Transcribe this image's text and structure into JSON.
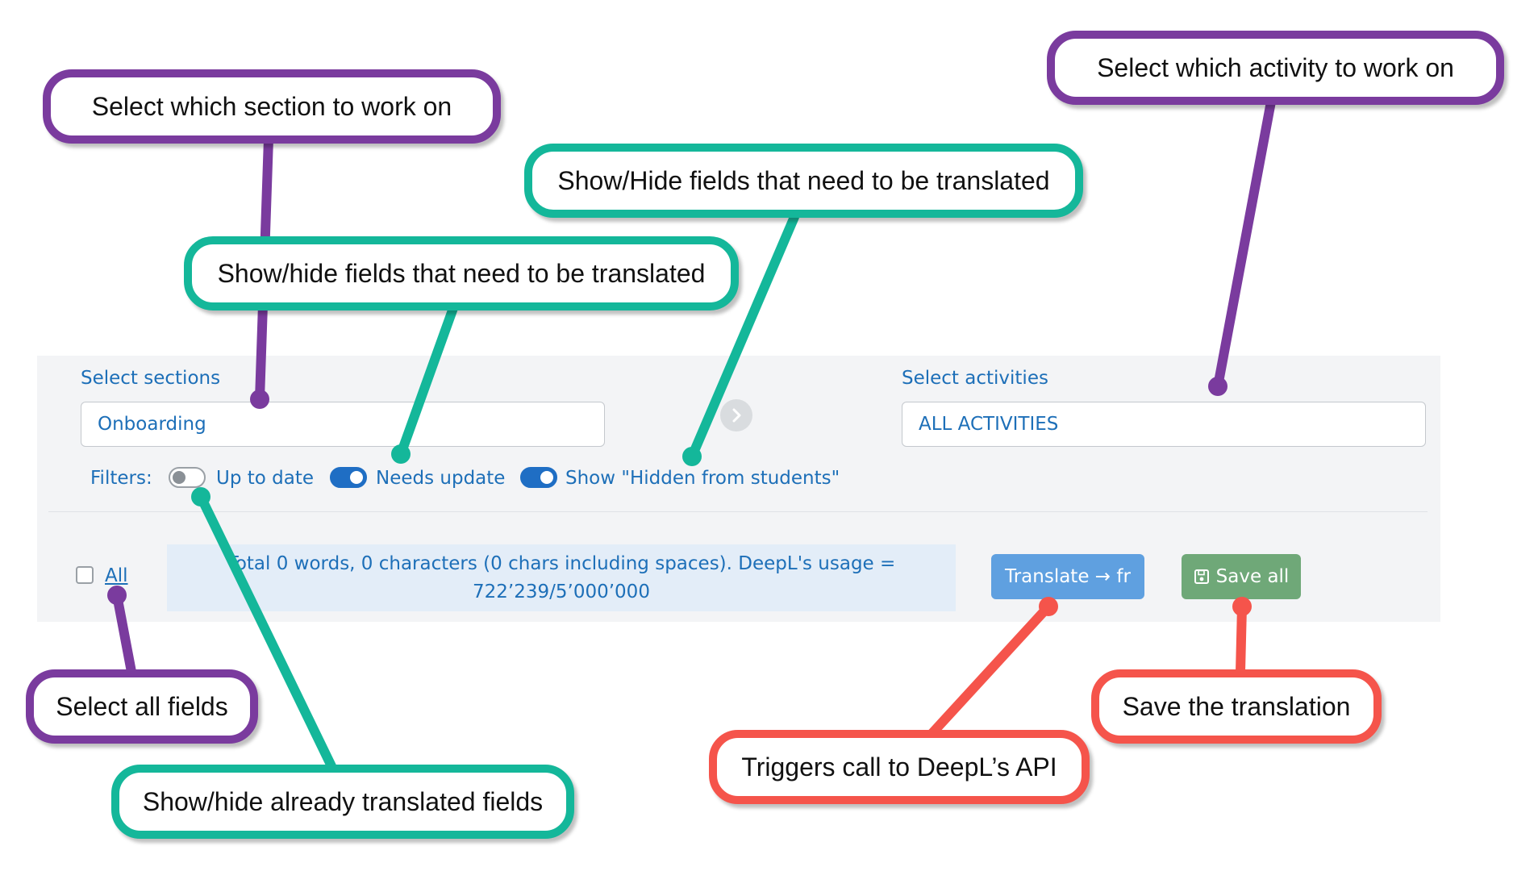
{
  "panel": {
    "sections_label": "Select sections",
    "sections_value": "Onboarding",
    "activities_label": "Select activities",
    "activities_value": "ALL ACTIVITIES",
    "filters_label": "Filters:",
    "filters": [
      {
        "label": "Up to date",
        "on": false
      },
      {
        "label": "Needs update",
        "on": true
      },
      {
        "label": "Show \"Hidden from students\"",
        "on": true
      }
    ],
    "select_all_label": "All",
    "info_line1": "Total 0 words, 0 characters (0 chars including spaces). DeepL's usage =",
    "info_line2": "722’239/5’000’000",
    "translate_label": "Translate → fr",
    "save_label": "Save all"
  },
  "callouts": {
    "section": "Select which section to work on",
    "activity": "Select which activity to work on",
    "show_hide_upper": "Show/Hide fields that need to be translated",
    "show_hide_lower": "Show/hide fields that need to be translated",
    "select_all": "Select all fields",
    "already_translated": "Show/hide already translated fields",
    "deepl": "Triggers call to DeepL’s API",
    "save": "Save the translation"
  },
  "colors": {
    "purple": "#7a3b9e",
    "teal": "#14b79a",
    "red": "#f5544b",
    "ui_blue": "#1d6fb8",
    "translate_button": "#5fa0e0",
    "save_button": "#6fa878"
  }
}
